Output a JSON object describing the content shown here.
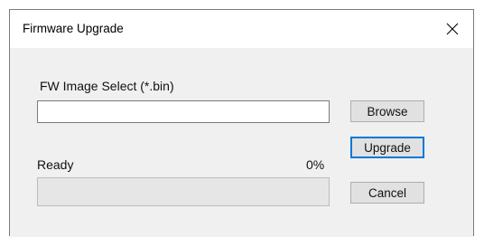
{
  "window": {
    "title": "Firmware Upgrade"
  },
  "fw_select": {
    "label": "FW Image Select (*.bin)",
    "value": "",
    "placeholder": ""
  },
  "status": {
    "text": "Ready",
    "percent_text": "0%",
    "progress_fraction": 0
  },
  "buttons": {
    "browse": "Browse",
    "upgrade": "Upgrade",
    "cancel": "Cancel"
  },
  "icons": {
    "close": "close-icon"
  },
  "colors": {
    "focus_accent": "#0078d7",
    "progress_fill": "#06b025"
  }
}
